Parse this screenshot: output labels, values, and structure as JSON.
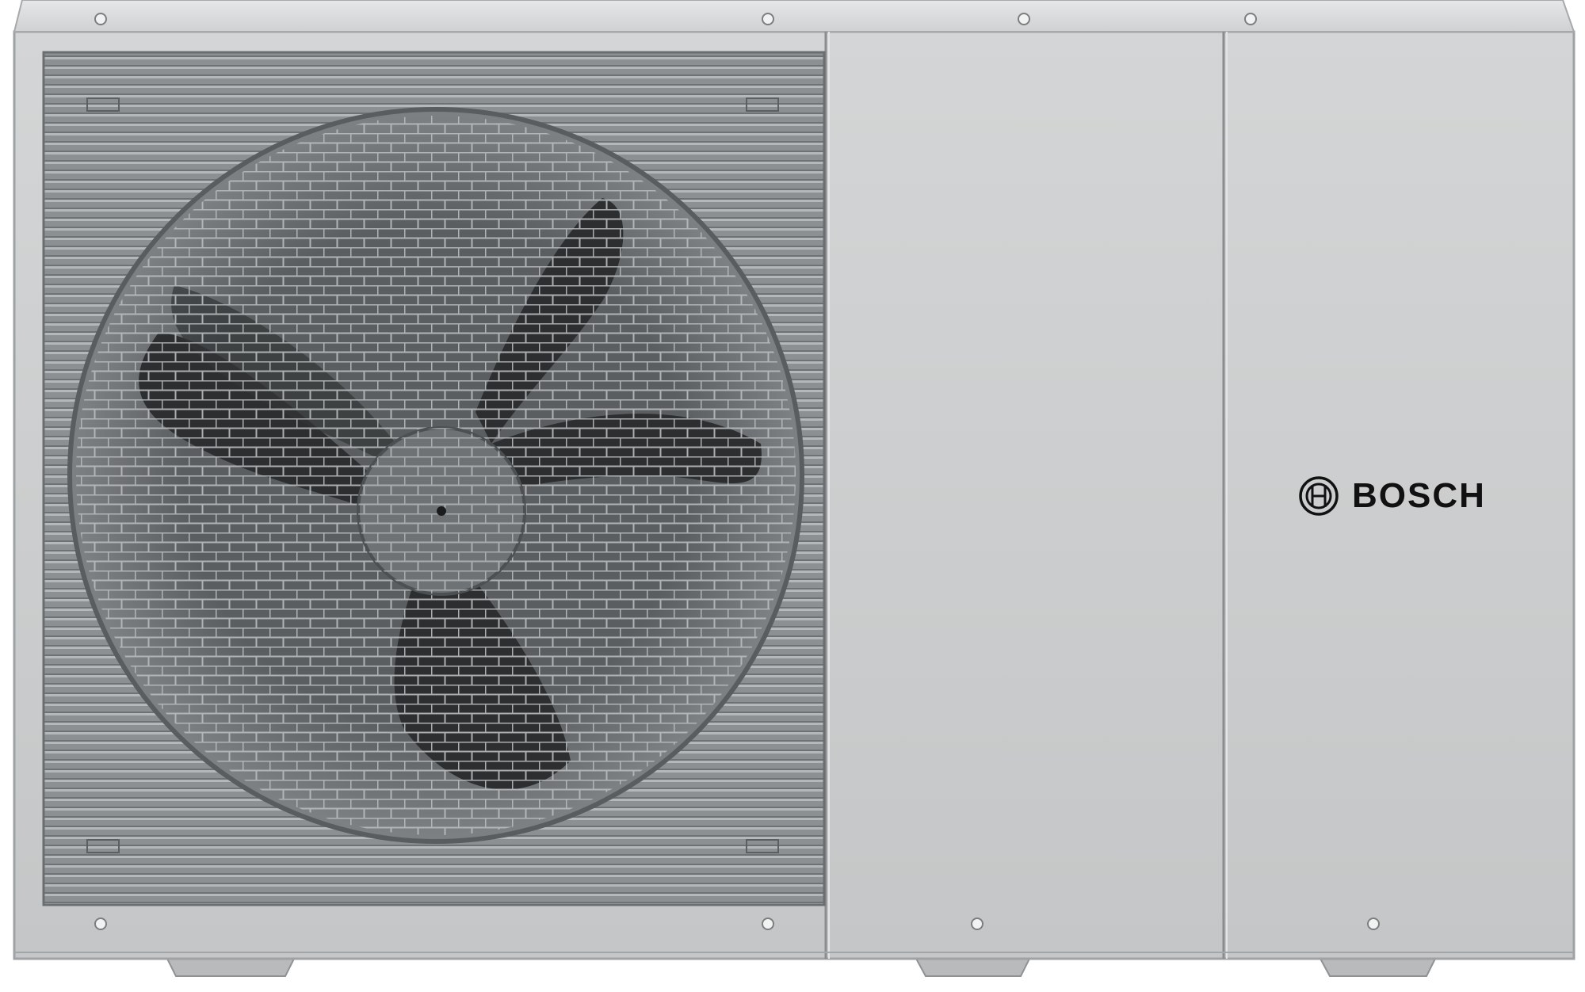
{
  "product": {
    "brand_name": "BOSCH",
    "brand_logo_icon": "bosch-armature-logo-icon"
  },
  "colors": {
    "casing": "#c9cbcc",
    "casing_shadow": "#a9abad",
    "grille": "#8e9193",
    "fan_blade": "#2b2d2f",
    "brand_text": "#111111"
  }
}
